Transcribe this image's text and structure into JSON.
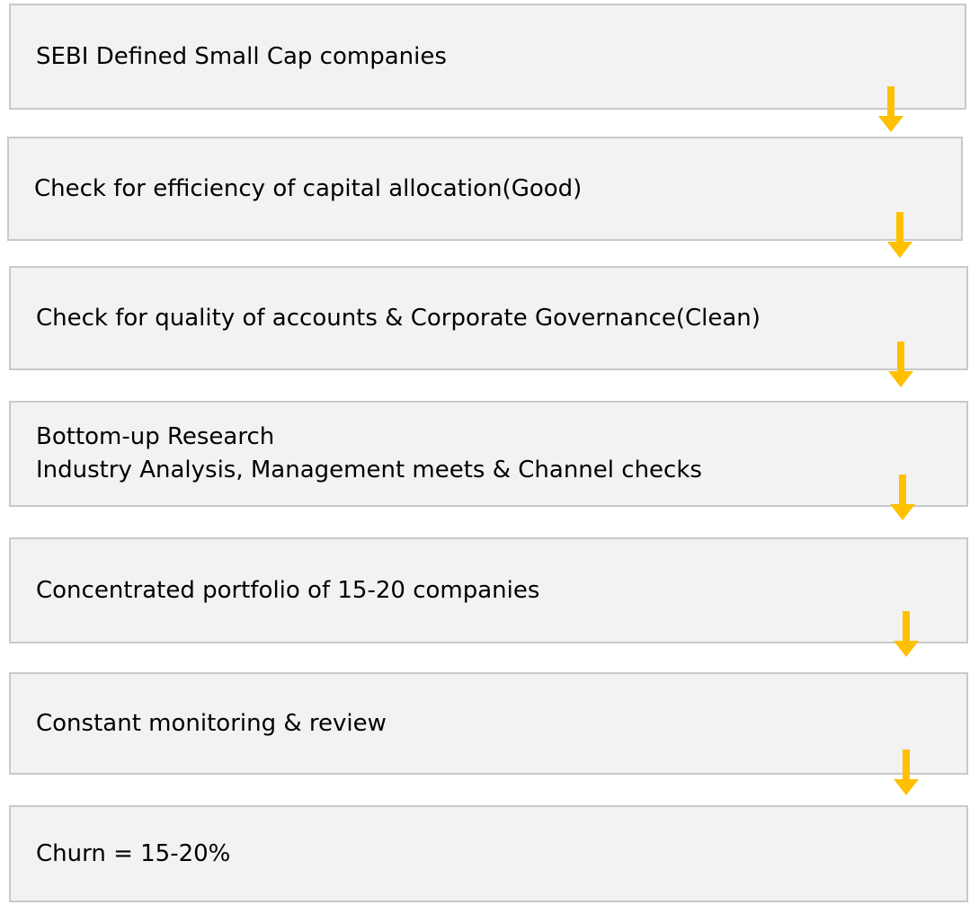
{
  "flow": {
    "steps": [
      {
        "label": "SEBI Defined Small Cap companies"
      },
      {
        "label": "Check for efficiency of capital allocation(Good)"
      },
      {
        "label": "Check for quality of accounts & Corporate Governance(Clean)"
      },
      {
        "label": "Bottom-up Research\nIndustry Analysis, Management meets & Channel checks"
      },
      {
        "label": "Concentrated portfolio of 15-20 companies"
      },
      {
        "label": "Constant monitoring & review"
      },
      {
        "label": "Churn = 15-20%"
      }
    ],
    "arrow_color": "#FFC000",
    "arrow_icon": "down-arrow-icon"
  }
}
